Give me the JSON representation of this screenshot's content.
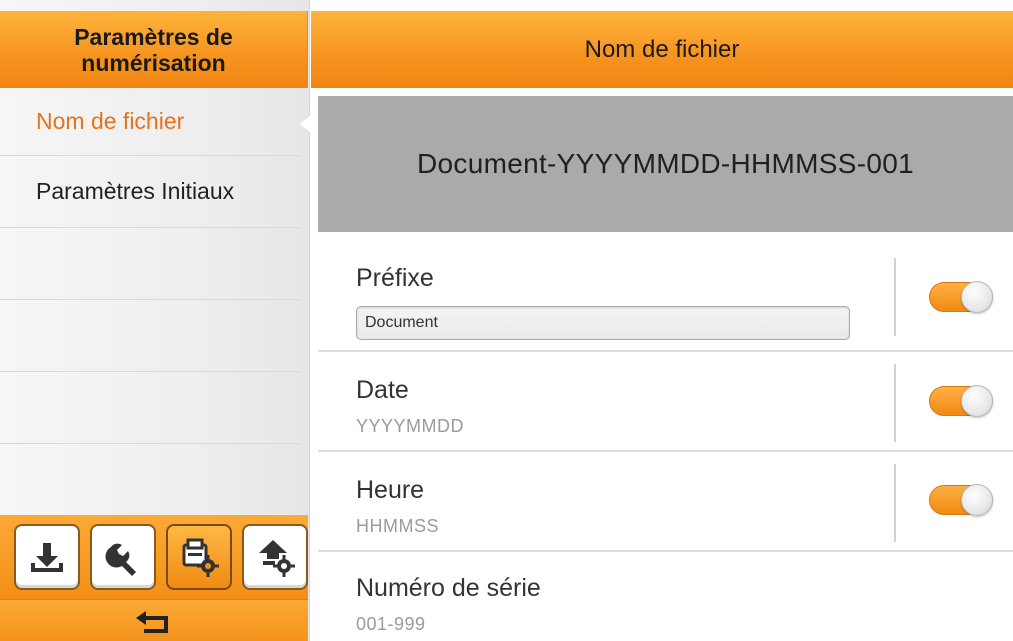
{
  "sidebar": {
    "title": "Paramètres de numérisation",
    "items": [
      {
        "label": "Nom de fichier",
        "active": true
      },
      {
        "label": "Paramètres Initiaux",
        "active": false
      }
    ],
    "toolbar": [
      {
        "icon": "download-icon"
      },
      {
        "icon": "wrench-icon"
      },
      {
        "icon": "scan-settings-icon",
        "selected": true
      },
      {
        "icon": "upload-settings-icon"
      }
    ],
    "back_icon": "back-arrow-icon"
  },
  "main": {
    "title": "Nom de fichier",
    "preview": "Document-YYYYMMDD-HHMMSS-001",
    "rows": {
      "prefix": {
        "label": "Préfixe",
        "value": "Document",
        "enabled": true
      },
      "date": {
        "label": "Date",
        "value": "YYYYMMDD",
        "enabled": true
      },
      "time": {
        "label": "Heure",
        "value": "HHMMSS",
        "enabled": true
      },
      "serial": {
        "label": "Numéro de série",
        "value": "001-999"
      }
    }
  },
  "colors": {
    "accent": "#f7941d",
    "active_text": "#e5731a",
    "preview_bg": "#aaaaaa"
  }
}
